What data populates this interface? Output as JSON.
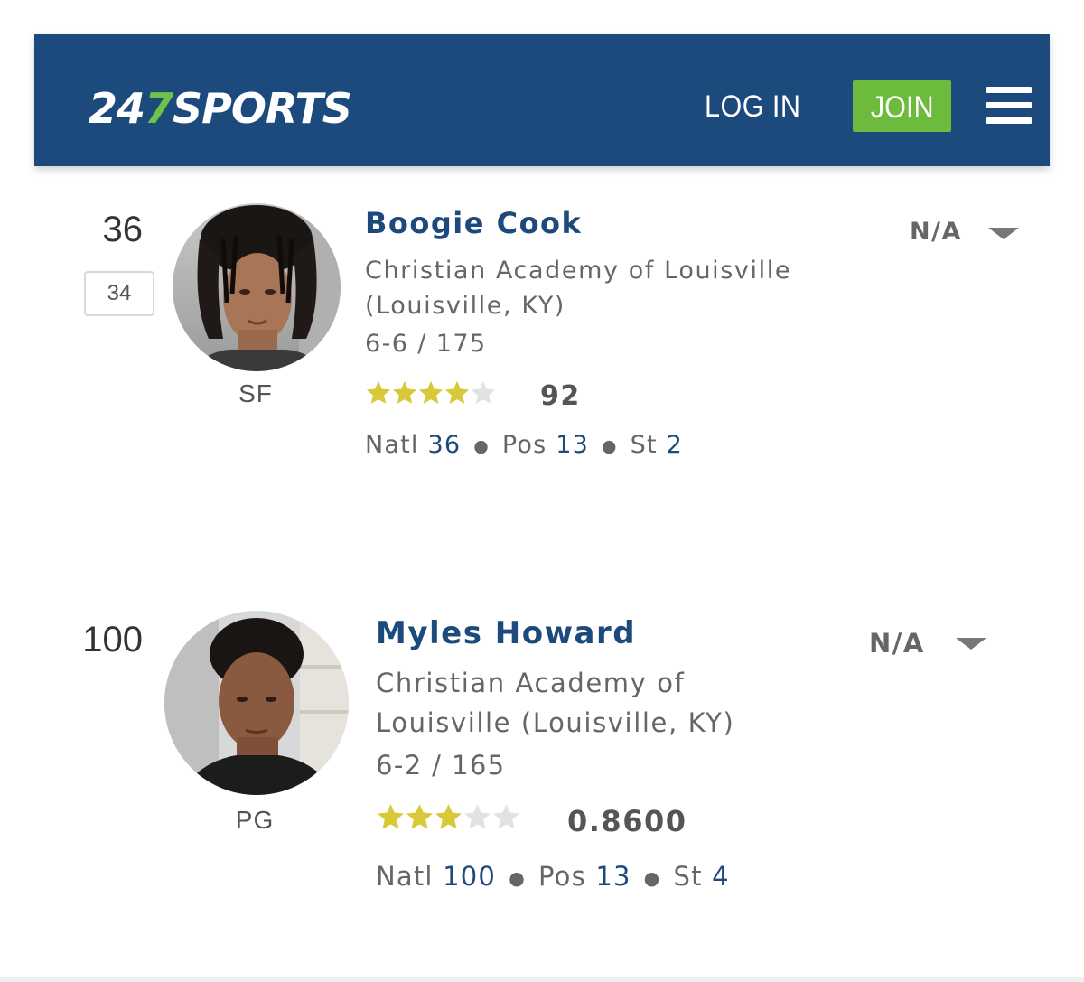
{
  "header": {
    "logo_prefix": "24",
    "logo_seven": "7",
    "logo_suffix": "SPORTS",
    "login_label": "LOG IN",
    "join_label": "JOIN",
    "brand_color": "#1d4a7d",
    "accent_color": "#6cbb3c",
    "menu_icon": "hamburger-menu-icon"
  },
  "players": [
    {
      "rank": "36",
      "previous_rank": "34",
      "position": "SF",
      "name": "Boogie Cook",
      "school_line1": "Christian Academy of Louisville",
      "school_line2": "(Louisville, KY)",
      "measurements": "6-6 / 175",
      "stars": 4,
      "stars_total": 5,
      "rating": "92",
      "natl_label": "Natl",
      "natl_rank": "36",
      "pos_label": "Pos",
      "pos_rank": "13",
      "st_label": "St",
      "st_rank": "2",
      "status": "N/A"
    },
    {
      "rank": "100",
      "position": "PG",
      "name": "Myles Howard",
      "school_line1": "Christian Academy of",
      "school_line2": "Louisville (Louisville, KY)",
      "measurements": "6-2 / 165",
      "stars": 3,
      "stars_total": 5,
      "rating": "0.8600",
      "natl_label": "Natl",
      "natl_rank": "100",
      "pos_label": "Pos",
      "pos_rank": "13",
      "st_label": "St",
      "st_rank": "4",
      "status": "N/A"
    }
  ],
  "colors": {
    "star_filled": "#d9c93a",
    "star_empty": "#e2e2e2",
    "link": "#1d4a7d"
  }
}
